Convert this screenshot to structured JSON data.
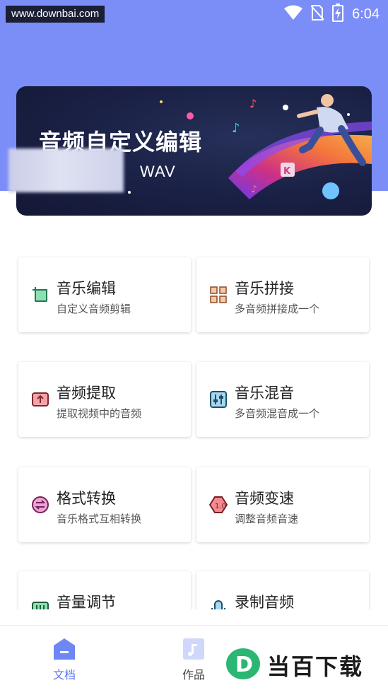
{
  "status_bar": {
    "watermark": "www.downbai.com",
    "time": "6:04",
    "icons": [
      "wifi-icon",
      "no-sim-icon",
      "battery-charging-icon"
    ]
  },
  "banner": {
    "title": "音频自定义编辑",
    "subtitle": "WAV"
  },
  "features": [
    {
      "title": "音乐编辑",
      "desc": "自定义音频剪辑",
      "icon": "crop-icon",
      "color": "#3aaa77"
    },
    {
      "title": "音乐拼接",
      "desc": "多音频拼接成一个",
      "icon": "grid-merge-icon",
      "color": "#e4834d"
    },
    {
      "title": "音频提取",
      "desc": "提取视频中的音频",
      "icon": "extract-icon",
      "color": "#e0555b"
    },
    {
      "title": "音乐混音",
      "desc": "多音频混音成一个",
      "icon": "mixer-icon",
      "color": "#2d87b5"
    },
    {
      "title": "格式转换",
      "desc": "音乐格式互相转换",
      "icon": "convert-icon",
      "color": "#c23a8f"
    },
    {
      "title": "音频变速",
      "desc": "调整音频音速",
      "icon": "speed-icon",
      "color": "#c9353b"
    },
    {
      "title": "音量调节",
      "desc": "",
      "icon": "volume-icon",
      "color": "#3aaa77"
    },
    {
      "title": "录制音频",
      "desc": "",
      "icon": "mic-icon",
      "color": "#2d87b5"
    }
  ],
  "bottom_nav": {
    "items": [
      {
        "label": "文档",
        "icon": "document-icon",
        "active": true
      },
      {
        "label": "作品",
        "icon": "music-note-icon",
        "active": false
      }
    ]
  },
  "brand_watermark": "当百下载",
  "colors": {
    "accent": "#7b8df7",
    "active_nav": "#5f79f0",
    "banner_bg": "#1a2044"
  }
}
